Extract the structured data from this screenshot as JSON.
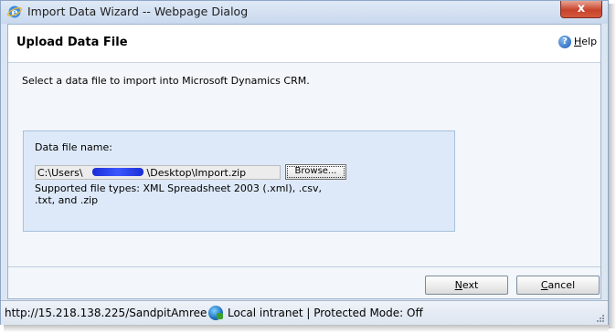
{
  "window": {
    "title": "Import Data Wizard -- Webpage Dialog",
    "close_glyph": "x",
    "icons": {
      "app": "ie-icon",
      "close": "close-icon"
    }
  },
  "header": {
    "title": "Upload Data File",
    "help_prefix": "H",
    "help_rest": "elp",
    "help_icon_glyph": "?"
  },
  "main": {
    "instruction": "Select a data file to import into Microsoft Dynamics CRM.",
    "file_label": "Data file name:",
    "file_value": "C:\\Users\\                    \\Desktop\\Import.zip",
    "browse_label": "Browse...",
    "supported_types": "Supported file types: XML Spreadsheet 2003 (.xml), .csv, .txt, and .zip"
  },
  "footer": {
    "next_prefix": "N",
    "next_rest": "ext",
    "cancel_prefix": "C",
    "cancel_rest": "ancel"
  },
  "statusbar": {
    "url": "http://15.218.138.225/SandpitAmreek",
    "zone": "Local intranet | Protected Mode: Off",
    "icons": {
      "zone": "globe-icon",
      "resize": "resize-grip-icon"
    }
  },
  "colors": {
    "dialog_bg": "#dbe6f3",
    "panel_bg": "#dde9f8",
    "redaction": "#2a44f0",
    "close_button": "#c7432c"
  }
}
